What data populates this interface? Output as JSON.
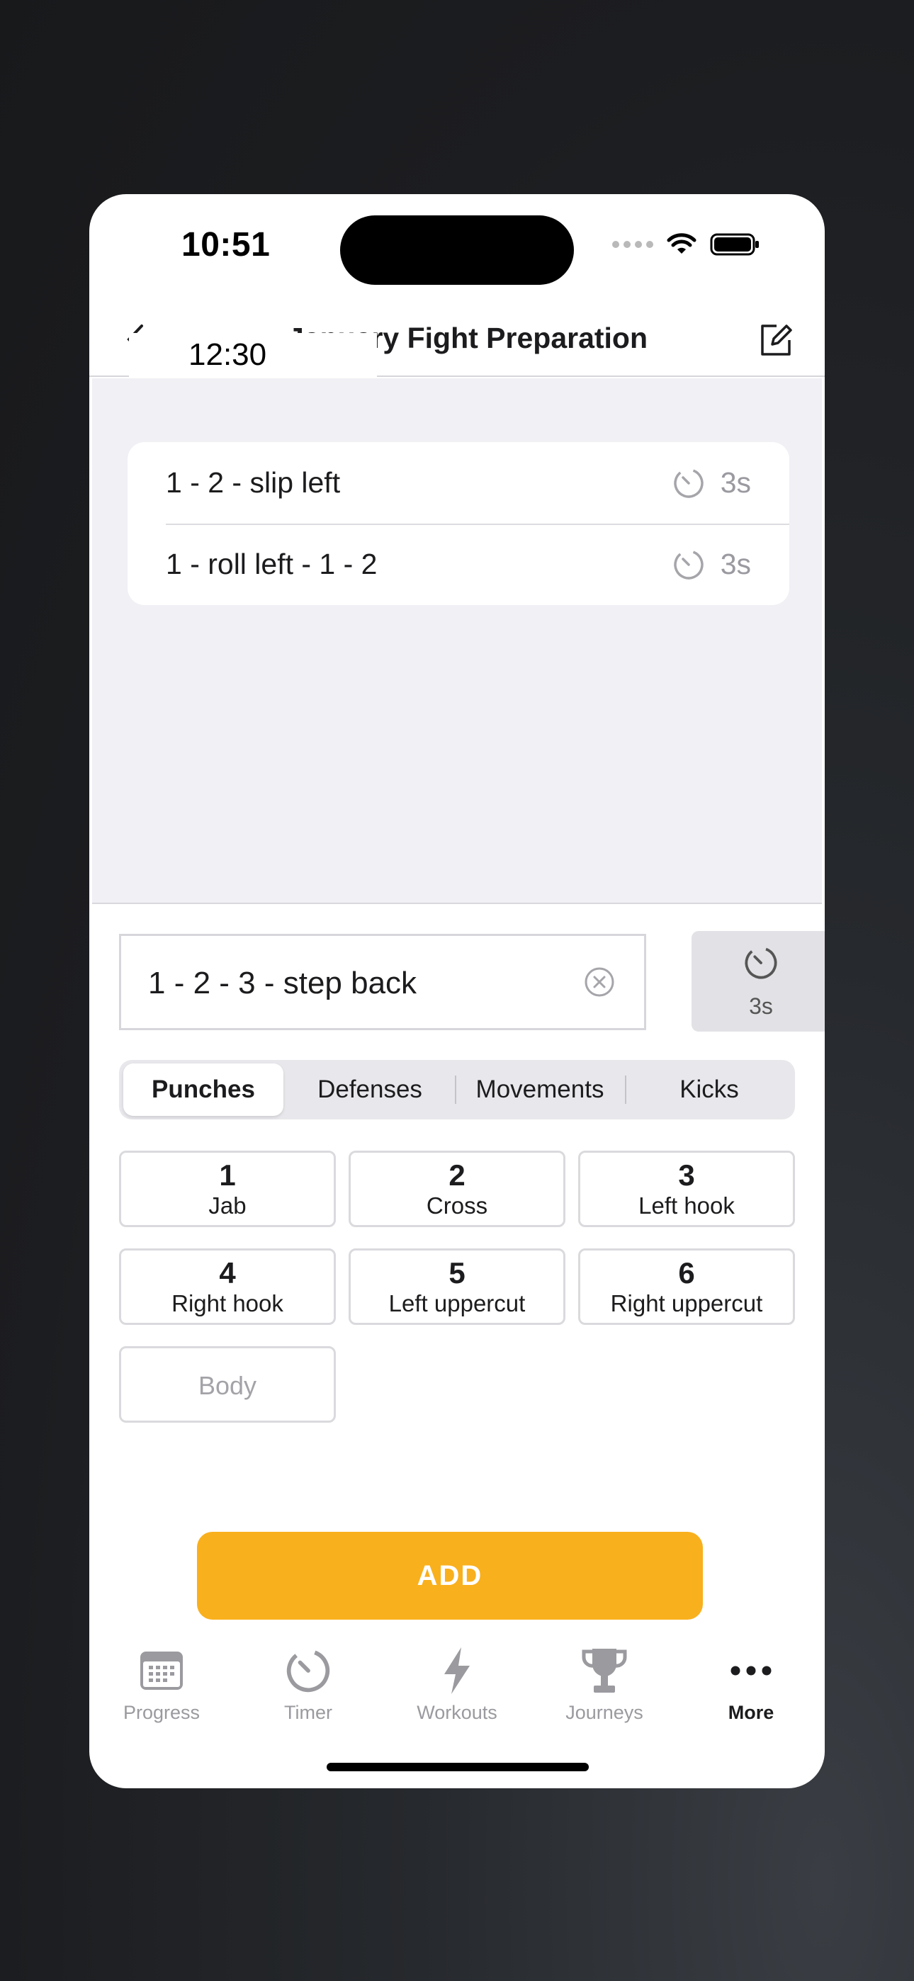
{
  "status": {
    "time": "10:51"
  },
  "nav": {
    "title": "January Fight Preparation",
    "overlay_time": "12:30"
  },
  "combos": [
    {
      "text": "1 - 2 - slip left",
      "duration": "3s"
    },
    {
      "text": "1 - roll left - 1 - 2",
      "duration": "3s"
    }
  ],
  "editor": {
    "value": "1 - 2 - 3 - step back",
    "timer_label": "3s"
  },
  "segments": [
    {
      "label": "Punches",
      "active": true
    },
    {
      "label": "Defenses"
    },
    {
      "label": "Movements"
    },
    {
      "label": "Kicks"
    }
  ],
  "punches": [
    {
      "num": "1",
      "name": "Jab"
    },
    {
      "num": "2",
      "name": "Cross"
    },
    {
      "num": "3",
      "name": "Left hook"
    },
    {
      "num": "4",
      "name": "Right hook"
    },
    {
      "num": "5",
      "name": "Left uppercut"
    },
    {
      "num": "6",
      "name": "Right uppercut"
    }
  ],
  "body_button": "Body",
  "add_button": "ADD",
  "tabs": [
    {
      "label": "Progress",
      "icon": "calendar-icon"
    },
    {
      "label": "Timer",
      "icon": "timer-icon"
    },
    {
      "label": "Workouts",
      "icon": "bolt-icon"
    },
    {
      "label": "Journeys",
      "icon": "trophy-icon"
    },
    {
      "label": "More",
      "icon": "more-icon",
      "active": true
    }
  ],
  "colors": {
    "accent": "#F9B01D",
    "list_background": "#F0F0F5"
  }
}
